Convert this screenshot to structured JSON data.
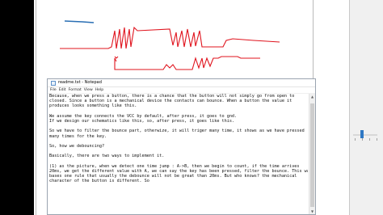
{
  "notepad": {
    "title": "readme.txt - Notepad",
    "icon": "notepad-icon",
    "menu": [
      "File",
      "Edit",
      "Format",
      "View",
      "Help"
    ],
    "lines": [
      "Because, when we press a button, there is a chance that the button will not simply go from open to",
      "closed. Since a button is a mechanical device the contacts can bounce. When a button the value it",
      "produces looks something like this.",
      "",
      "We assume the key connects the VCC by default, after press, it goes to gnd.",
      "If we design our schematics like this, so, after press, it goes like this.",
      "",
      "So we have to filter the bounce part, otherwize, it will triger many time, it shows as we have pressed",
      "many times for the key.",
      "",
      "So, how we debouncing?",
      "",
      "Basically, there are two ways to implement it.",
      "",
      "(1) as the picture, when we detect one time jump : A->B, then we begin to count, if the time arrives",
      "20ms, we get the different value with A, we can say the key has been pressed, filter the bounce. This way",
      "bases one rule that usually the debounce will not be great than 20ms. But who knows? the mechanical",
      "character of the button is different. So"
    ]
  },
  "colors": {
    "scribble": "#e0141e",
    "scribble_blue": "#2a6fb4",
    "accent_blue": "#2f78c4",
    "scrollbar_thumb": "#cdcdcd"
  }
}
